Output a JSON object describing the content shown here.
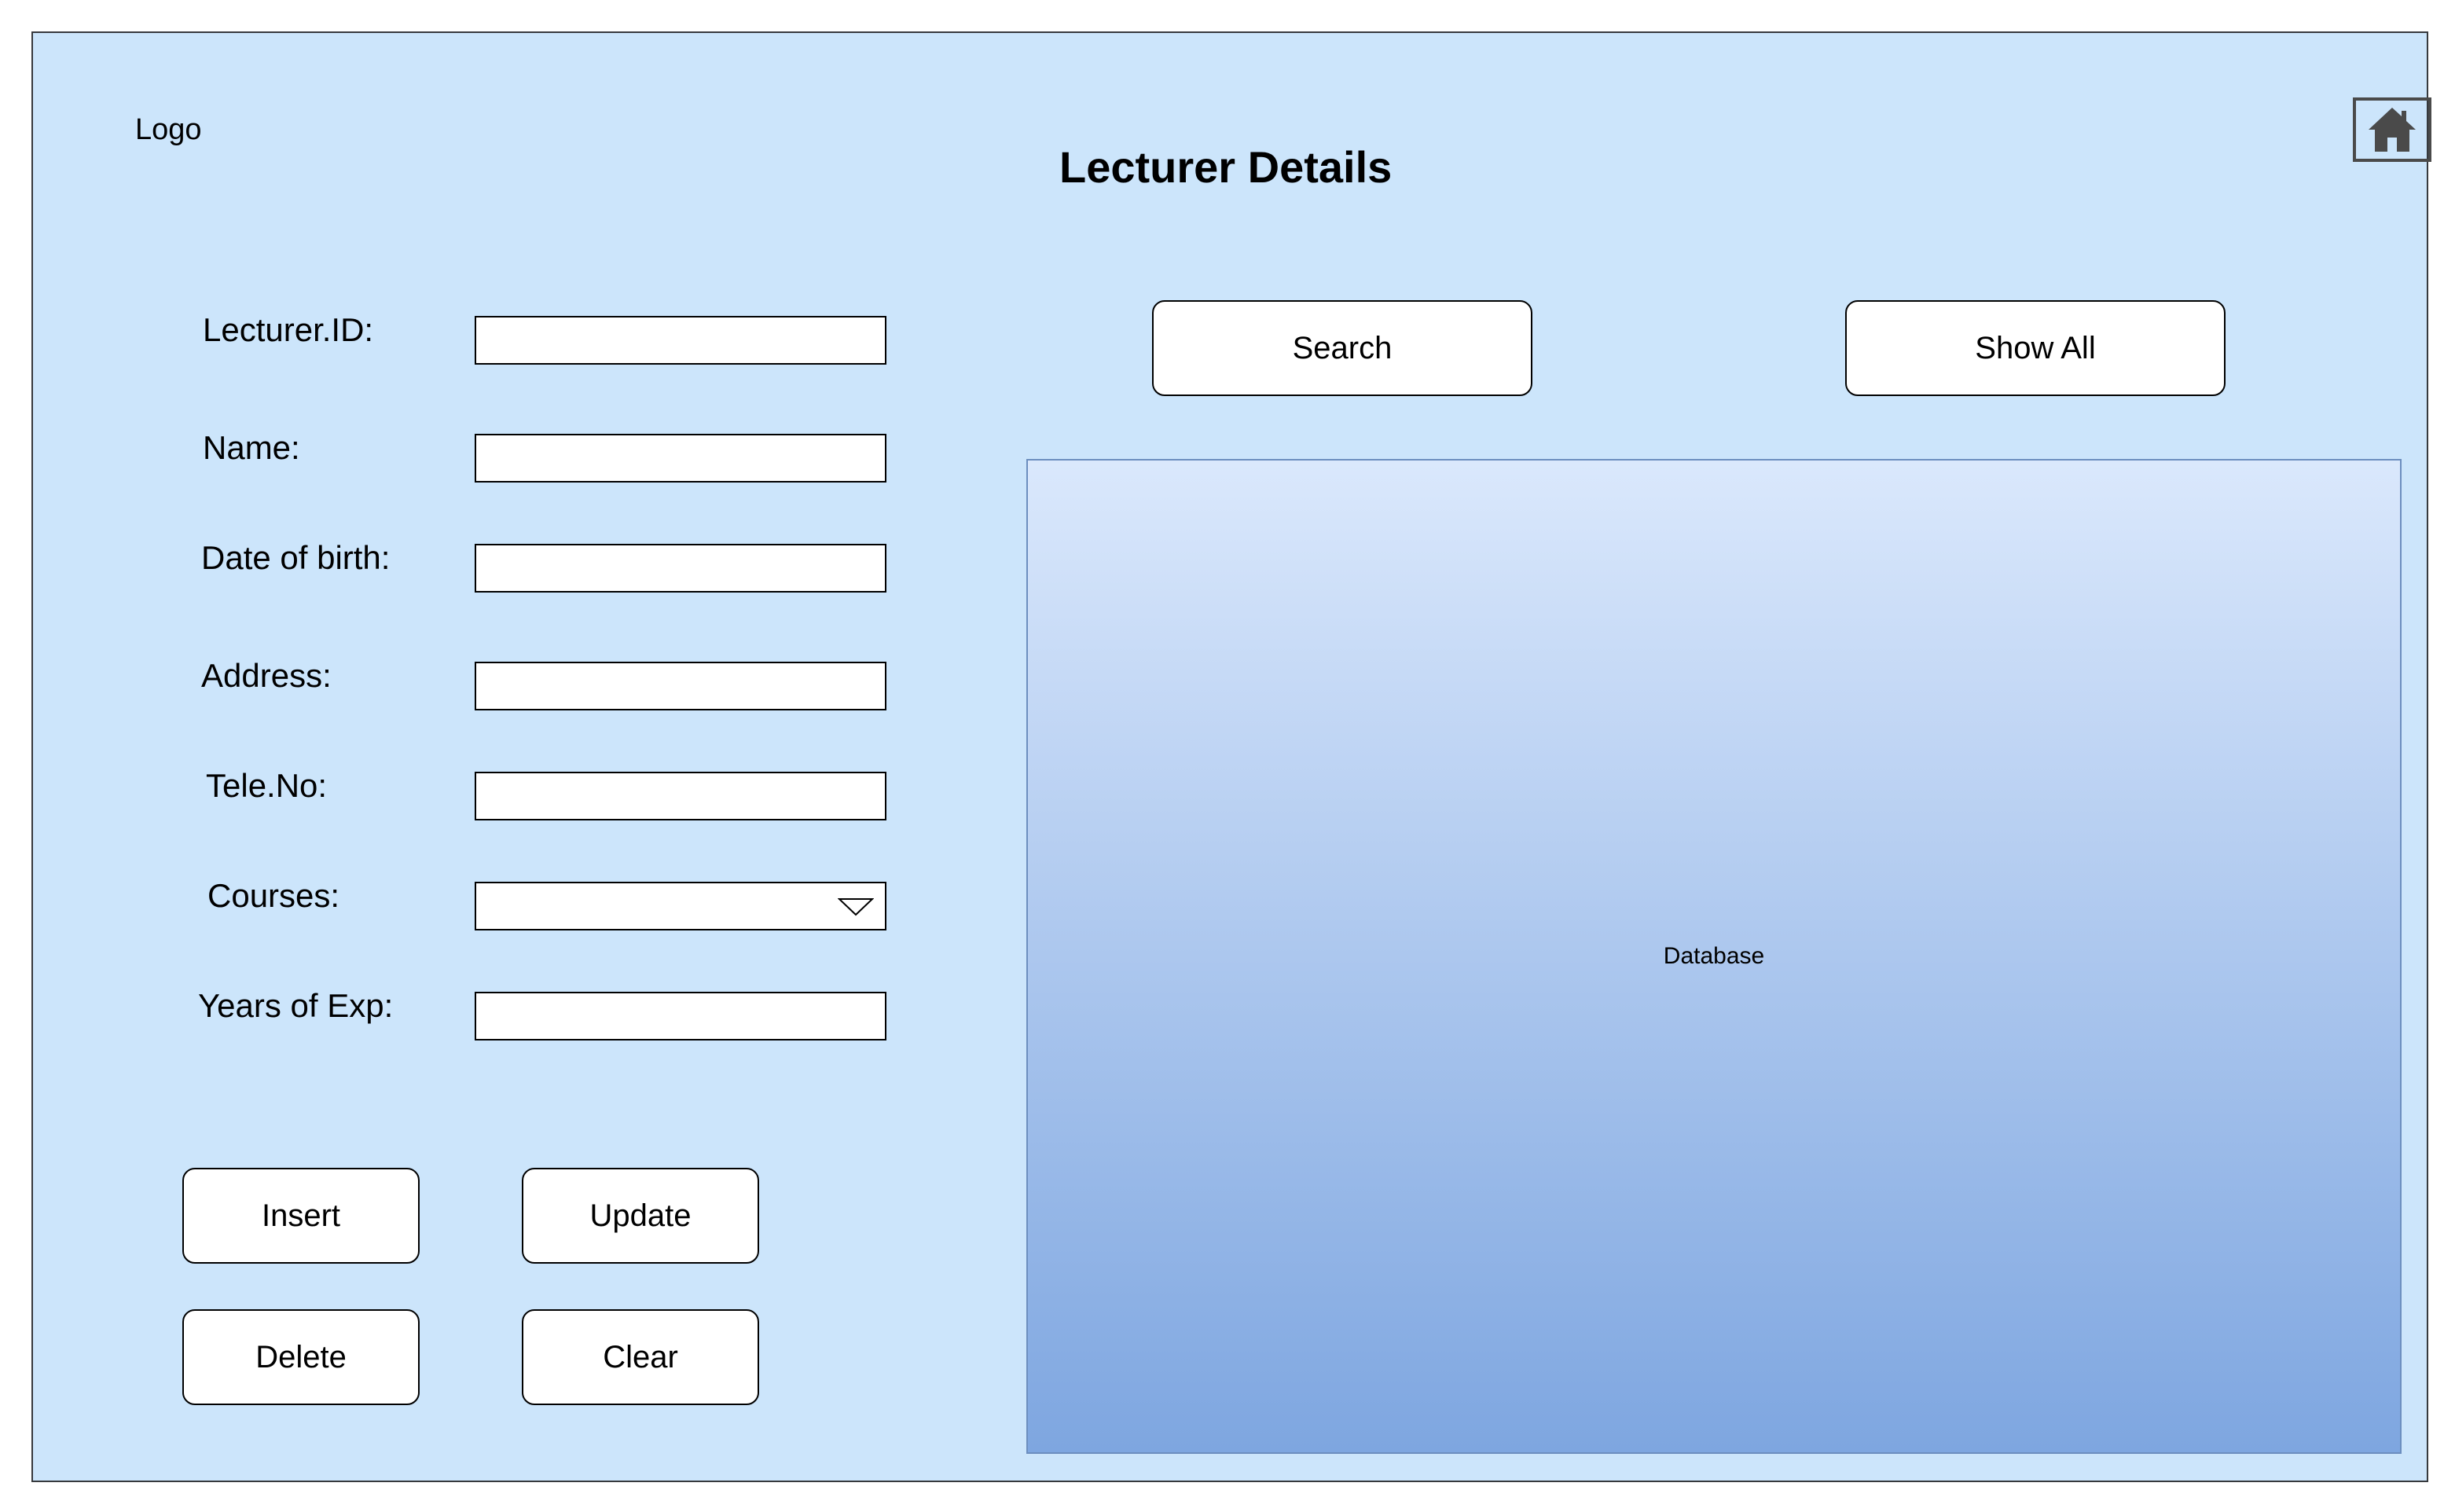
{
  "header": {
    "logo_text": "Logo",
    "title": "Lecturer Details",
    "home_icon": "home-icon"
  },
  "form": {
    "fields": [
      {
        "label": "Lecturer.ID:",
        "value": "",
        "type": "text"
      },
      {
        "label": "Name:",
        "value": "",
        "type": "text"
      },
      {
        "label": "Date of birth:",
        "value": "",
        "type": "text"
      },
      {
        "label": "Address:",
        "value": "",
        "type": "text"
      },
      {
        "label": "Tele.No:",
        "value": "",
        "type": "text"
      },
      {
        "label": "Courses:",
        "value": "",
        "type": "select"
      },
      {
        "label": "Years of Exp:",
        "value": "",
        "type": "text"
      }
    ]
  },
  "actions": {
    "insert": "Insert",
    "update": "Update",
    "delete": "Delete",
    "clear": "Clear"
  },
  "toolbar": {
    "search": "Search",
    "show_all": "Show All"
  },
  "database": {
    "label": "Database"
  },
  "colors": {
    "background": "#cce5fb",
    "panel_top": "#dae8fc",
    "panel_bottom": "#7ea6e0",
    "panel_border": "#6c8ebf"
  }
}
